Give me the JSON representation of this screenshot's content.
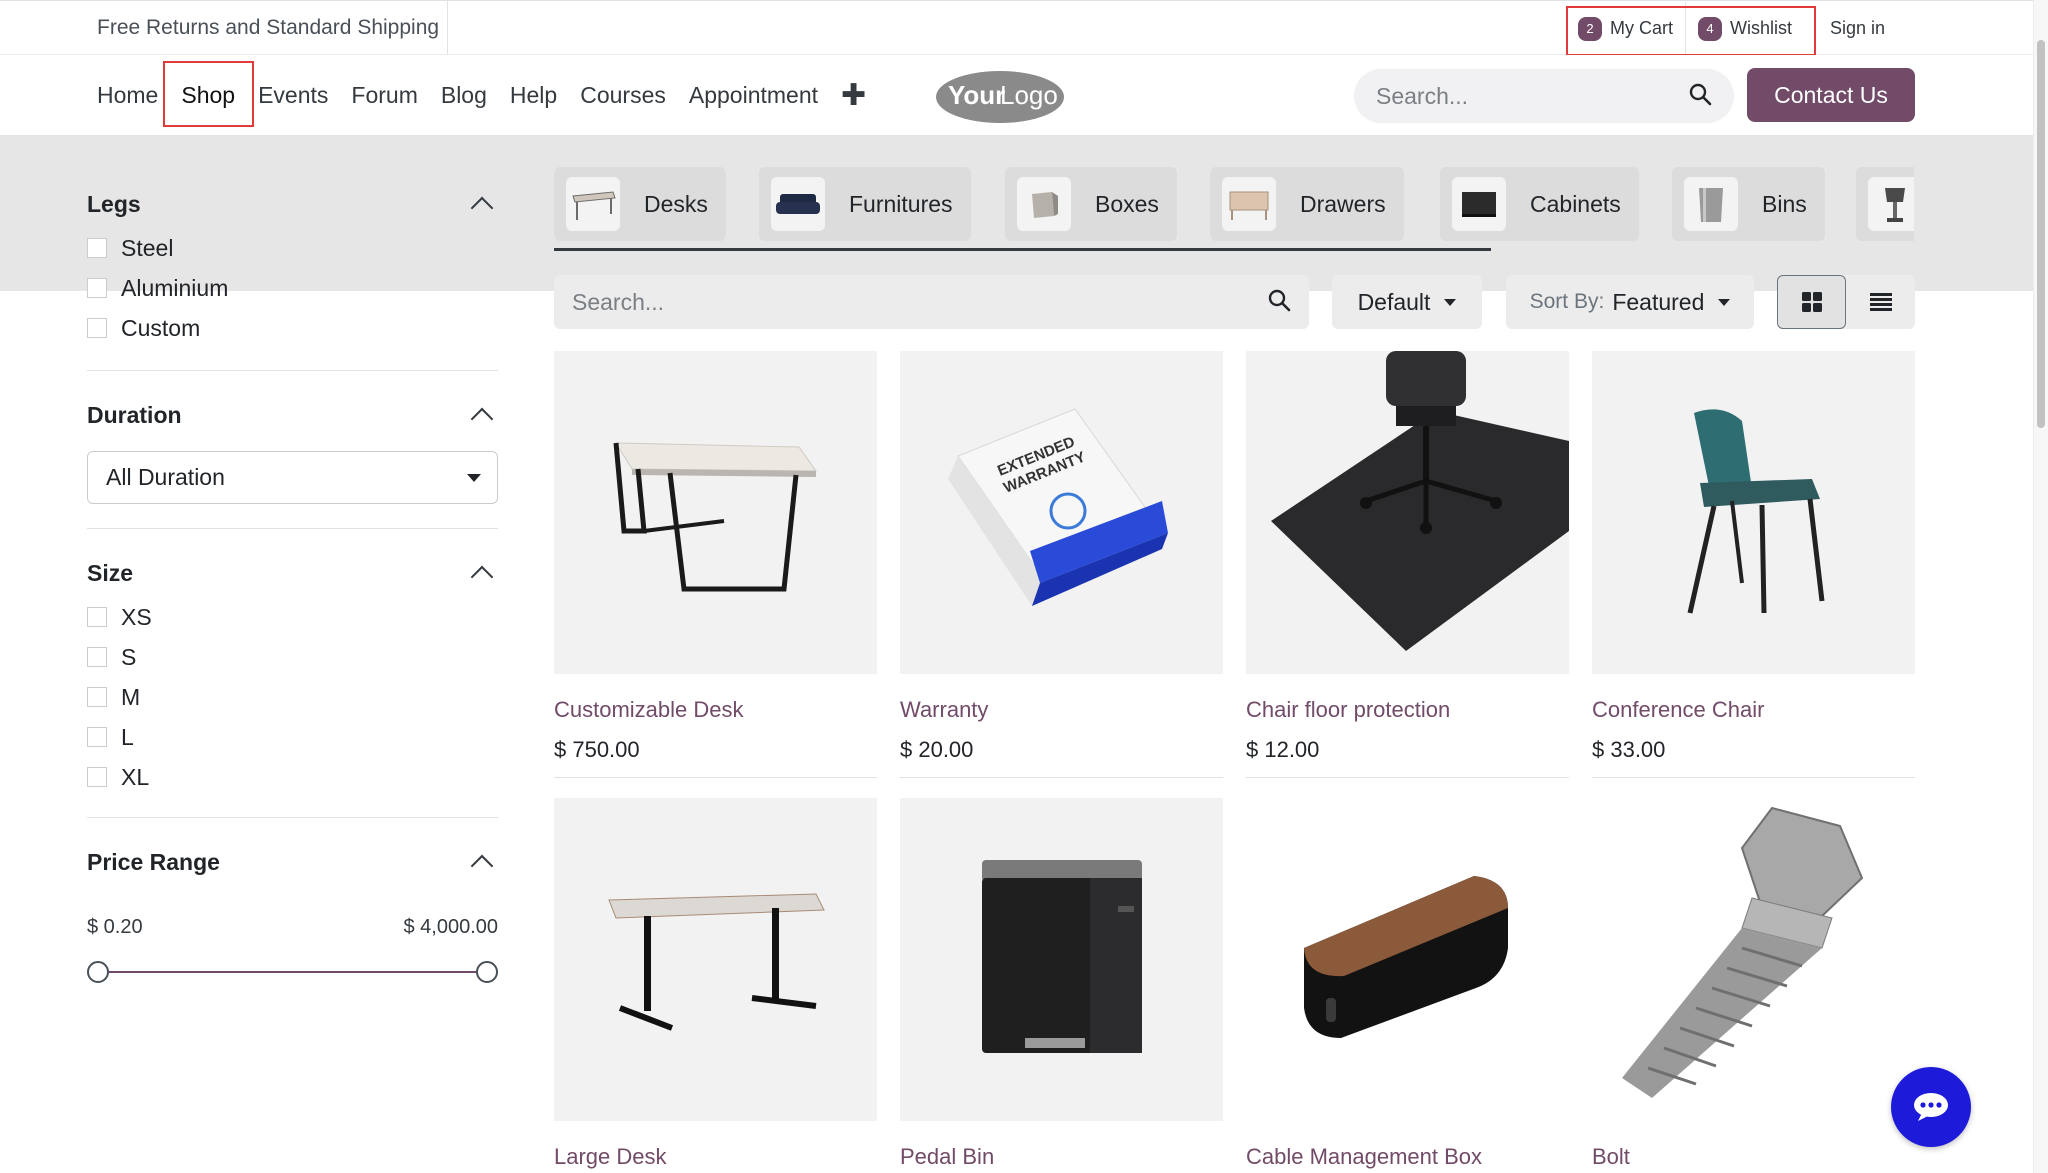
{
  "topbar": {
    "promo": "Free Returns and Standard Shipping",
    "cart": {
      "count": "2",
      "label": "My Cart"
    },
    "wishlist": {
      "count": "4",
      "label": "Wishlist"
    },
    "signin": "Sign in"
  },
  "nav": {
    "items": [
      "Home",
      "Shop",
      "Events",
      "Forum",
      "Blog",
      "Help",
      "Courses",
      "Appointment"
    ],
    "active": "Shop",
    "logo_text_a": "Your",
    "logo_text_b": "Logo",
    "search_placeholder": "Search...",
    "contact_label": "Contact Us"
  },
  "sidebar": {
    "legs": {
      "title": "Legs",
      "options": [
        "Steel",
        "Aluminium",
        "Custom"
      ]
    },
    "duration": {
      "title": "Duration",
      "selected": "All Duration"
    },
    "size": {
      "title": "Size",
      "options": [
        "XS",
        "S",
        "M",
        "L",
        "XL"
      ]
    },
    "price": {
      "title": "Price Range",
      "min_label": "$ 0.20",
      "max_label": "$ 4,000.00",
      "min": 0.2,
      "max": 4000.0,
      "low": 0.2,
      "high": 4000.0
    }
  },
  "categories": [
    "Desks",
    "Furnitures",
    "Boxes",
    "Drawers",
    "Cabinets",
    "Bins"
  ],
  "toolbar": {
    "search_placeholder": "Search...",
    "pricelist": "Default",
    "sort_prefix": "Sort By:",
    "sort_value": "Featured"
  },
  "products": [
    {
      "name": "Customizable Desk",
      "price": "$ 750.00"
    },
    {
      "name": "Warranty",
      "price": "$ 20.00"
    },
    {
      "name": "Chair floor protection",
      "price": "$ 12.00"
    },
    {
      "name": "Conference Chair",
      "price": "$ 33.00"
    },
    {
      "name": "Large Desk",
      "price": ""
    },
    {
      "name": "Pedal Bin",
      "price": ""
    },
    {
      "name": "Cable Management Box",
      "price": ""
    },
    {
      "name": "Bolt",
      "price": ""
    }
  ],
  "warranty_box_text": [
    "EXTENDED",
    "WARRANTY"
  ],
  "colors": {
    "brand": "#714b67",
    "chat": "#1d1bd9",
    "highlight": "#e03a3a"
  }
}
